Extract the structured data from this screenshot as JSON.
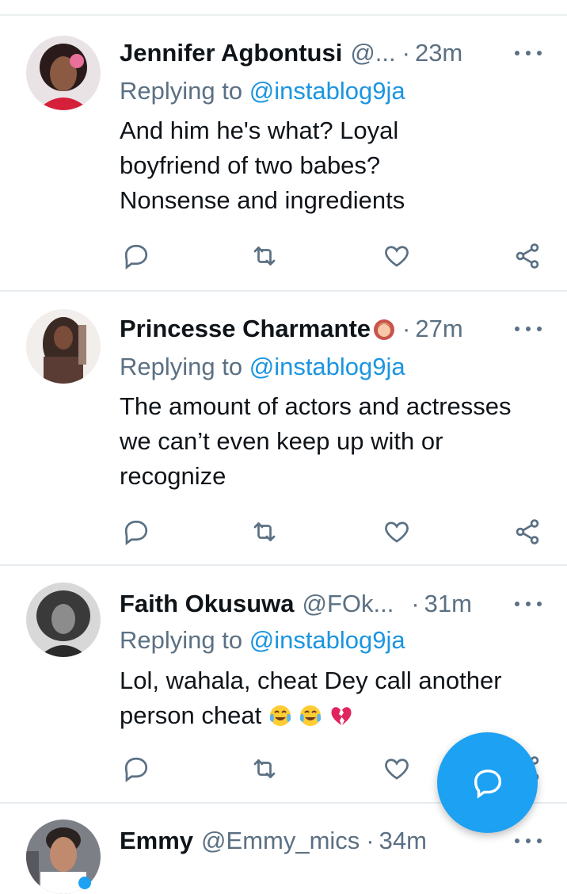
{
  "tweets": [
    {
      "name": "Jennifer Agbontusi",
      "handle": "@...",
      "dot": "·",
      "time": "23m",
      "reply_prefix": "Replying to",
      "reply_mention": "@instablog9ja",
      "body": "And him he's what? Loyal boyfriend of two babes? Nonsense and ingredients"
    },
    {
      "name": "Princesse Charmante",
      "handle": "",
      "dot": "·",
      "time": "27m",
      "reply_prefix": "Replying to",
      "reply_mention": "@instablog9ja",
      "body": "The amount of actors and actresses we can’t even keep up with or recognize"
    },
    {
      "name": "Faith Okusuwa",
      "handle": "@FOk...",
      "dot": "·",
      "time": "31m",
      "reply_prefix": "Replying to",
      "reply_mention": "@instablog9ja",
      "body": "Lol, wahala, cheat Dey call another person cheat"
    },
    {
      "name": "Emmy",
      "handle": "@Emmy_mics",
      "dot": "·",
      "time": "34m"
    }
  ],
  "icons": {
    "reply": "reply-icon",
    "retweet": "retweet-icon",
    "like": "heart-icon",
    "share": "share-icon",
    "more": "more-icon",
    "compose": "compose-reply-icon"
  },
  "colors": {
    "accent": "#1da1f2",
    "mention": "#1b95e0",
    "secondary_text": "#5b7083",
    "divider": "#e6ecf0"
  }
}
